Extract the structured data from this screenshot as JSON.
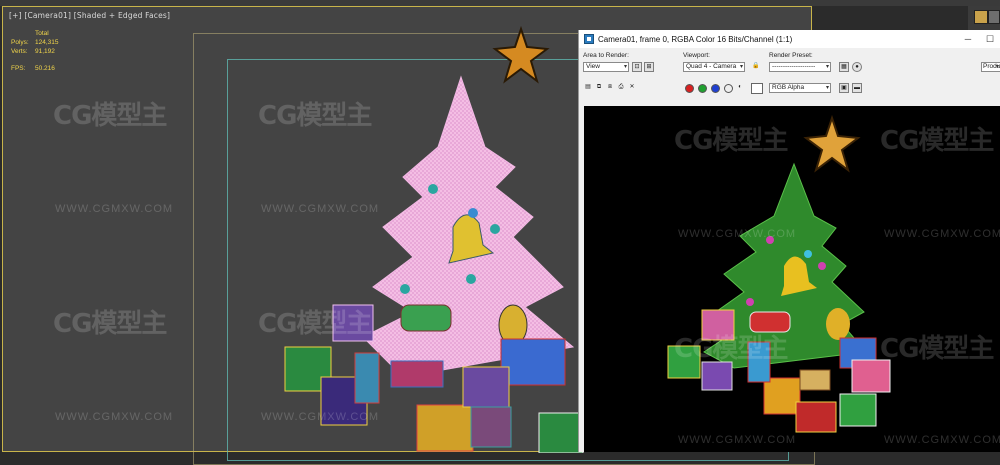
{
  "viewport": {
    "label": "[+] [Camera01] [Shaded + Edged Faces]",
    "stats": {
      "total_label": "Total",
      "polys_label": "Polys:",
      "polys_value": "124,315",
      "verts_label": "Verts:",
      "verts_value": "91,192",
      "fps_label": "FPS:",
      "fps_value": "50.216"
    }
  },
  "render_window": {
    "title": "Camera01, frame 0, RGBA Color 16 Bits/Channel (1:1)",
    "area_to_render_label": "Area to Render:",
    "area_to_render_value": "View",
    "viewport_label": "Viewport:",
    "viewport_value": "Quad 4 - Camera",
    "render_preset_label": "Render Preset:",
    "render_preset_value": "--------------------",
    "production_value": "Produc",
    "channel_value": "RGB Alpha"
  },
  "watermark": {
    "brand": "CG模型主",
    "url": "WWW.CGMXW.COM"
  },
  "colors": {
    "viewport_bg": "#444444",
    "stats_yellow": "#f0d44a",
    "render_bg": "#000000"
  }
}
